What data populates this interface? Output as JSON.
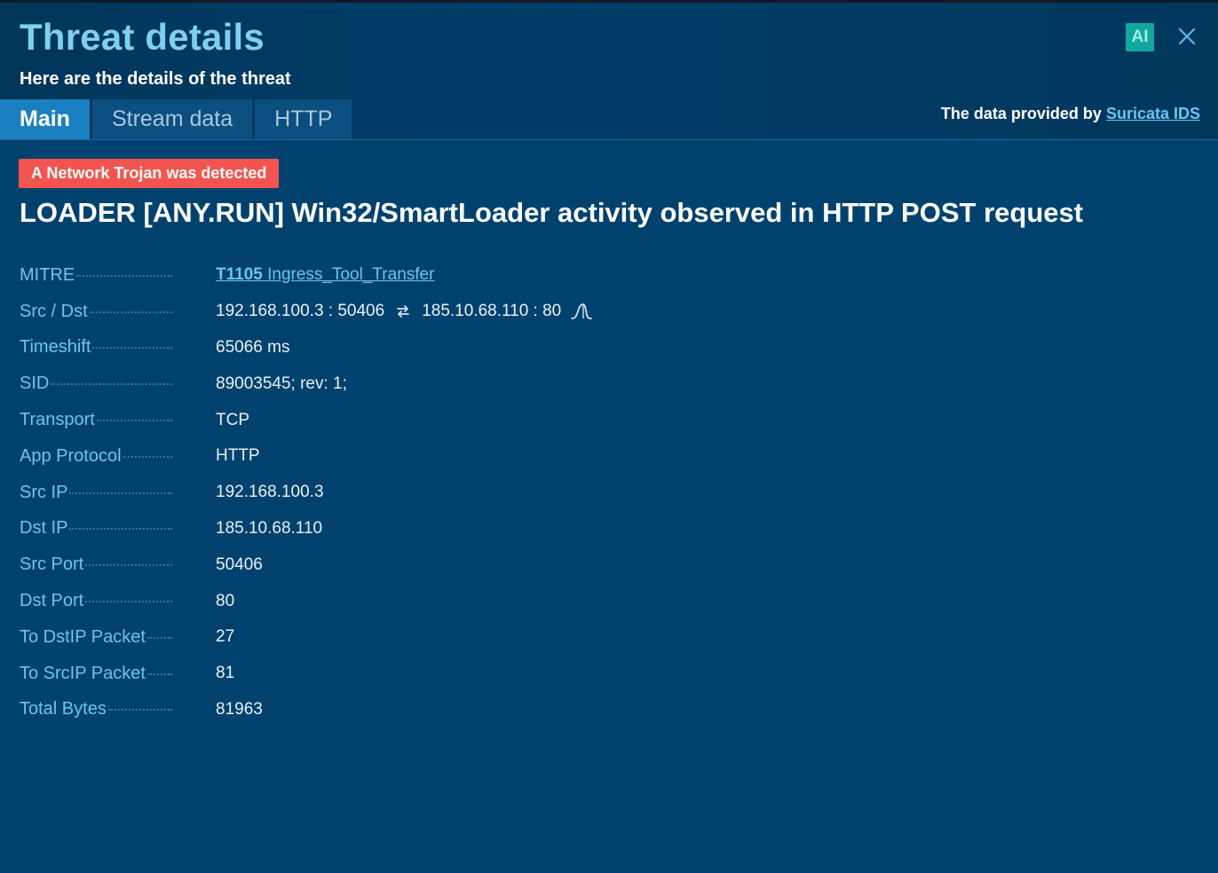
{
  "header": {
    "title": "Threat details",
    "subtitle": "Here are the details of the threat",
    "ai_label": "AI",
    "provider_prefix": "The data provided by",
    "provider_link": "Suricata IDS"
  },
  "tabs": [
    {
      "label": "Main",
      "active": true
    },
    {
      "label": "Stream data",
      "active": false
    },
    {
      "label": "HTTP",
      "active": false
    }
  ],
  "alert": {
    "badge": "A Network Trojan was detected",
    "name": "LOADER [ANY.RUN] Win32/SmartLoader activity observed in HTTP POST request"
  },
  "details": {
    "mitre": {
      "label": "MITRE",
      "id": "T1105",
      "name": "Ingress_Tool_Transfer"
    },
    "src_dst": {
      "label": "Src / Dst",
      "src": "192.168.100.3 : 50406",
      "dst": "185.10.68.110 : 80"
    },
    "timeshift": {
      "label": "Timeshift",
      "value": "65066 ms"
    },
    "sid": {
      "label": "SID",
      "value": "89003545; rev: 1;"
    },
    "transport": {
      "label": "Transport",
      "value": "TCP"
    },
    "app_protocol": {
      "label": "App Protocol",
      "value": "HTTP"
    },
    "src_ip": {
      "label": "Src IP",
      "value": "192.168.100.3"
    },
    "dst_ip": {
      "label": "Dst IP",
      "value": "185.10.68.110"
    },
    "src_port": {
      "label": "Src Port",
      "value": "50406"
    },
    "dst_port": {
      "label": "Dst Port",
      "value": "80"
    },
    "to_dstip_packet": {
      "label": "To DstIP Packet",
      "value": "27"
    },
    "to_srcip_packet": {
      "label": "To SrcIP Packet",
      "value": "81"
    },
    "total_bytes": {
      "label": "Total Bytes",
      "value": "81963"
    }
  },
  "colors": {
    "background": "#00426d",
    "title": "#7fd0f0",
    "label": "#6cc4f2",
    "active_tab": "#1a7fc0",
    "alert_badge": "#f2554f",
    "ai_button": "#12a8a0"
  },
  "icons": {
    "close": "close-icon",
    "swap": "swap-arrows-icon",
    "graph": "connection-graph-icon"
  }
}
